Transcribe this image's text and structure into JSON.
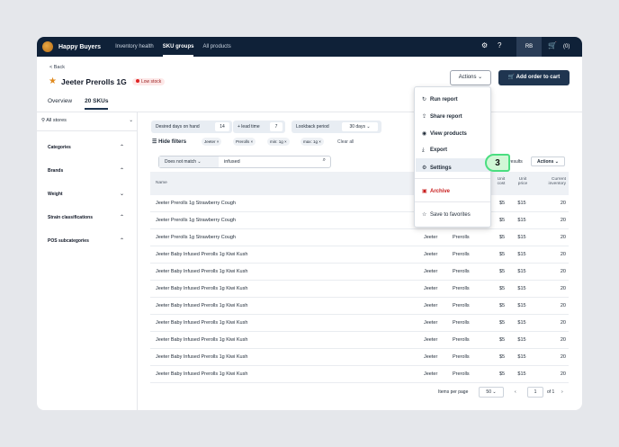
{
  "nav": {
    "brand": "Happy Buyers",
    "links": [
      "Inventory health",
      "SKU groups",
      "All products"
    ],
    "avatar": "RB",
    "cart_count": "(0)"
  },
  "header": {
    "back": "< Back",
    "title": "Jeeter Prerolls 1G",
    "badge": "Low stock",
    "actions": "Actions",
    "add_order": "Add order to cart"
  },
  "tabs": [
    "Overview",
    "20 SKUs"
  ],
  "sidebar": {
    "store": "All stores",
    "facets": [
      "Categories",
      "Brands",
      "Weight",
      "Strain classifications",
      "POS subcategories"
    ]
  },
  "filters": {
    "desired_label": "Desired days on hand",
    "desired_value": "14",
    "lead_label": "+ lead time",
    "lead_value": "7",
    "lookback_label": "Lookback period",
    "lookback_value": "30 days",
    "hide": "Hide filters",
    "chips": [
      "Jeeter",
      "Prerolls",
      "min: 1g",
      "max: 1g"
    ],
    "clear": "Clear all"
  },
  "search": {
    "mode": "Does not match",
    "value": "infused"
  },
  "table": {
    "results": "results",
    "actions": "Actions",
    "headers": {
      "name": "Name",
      "unit_cost": "Unit cost",
      "unit_price": "Unit price",
      "inventory": "Current inventory"
    },
    "rows": [
      {
        "name": "Jeeter Prerolls 1g Strawberry Cough",
        "brand": "",
        "category": "",
        "cost": "$5",
        "price": "$15",
        "inv": "20"
      },
      {
        "name": "Jeeter Prerolls 1g Strawberry Cough",
        "brand": "",
        "category": "",
        "cost": "$5",
        "price": "$15",
        "inv": "20"
      },
      {
        "name": "Jeeter Prerolls 1g Strawberry Cough",
        "brand": "Jeeter",
        "category": "Prerolls",
        "cost": "$5",
        "price": "$15",
        "inv": "20"
      },
      {
        "name": "Jeeter Baby Infused Prerolls 1g Kiwi Kush",
        "brand": "Jeeter",
        "category": "Prerolls",
        "cost": "$5",
        "price": "$15",
        "inv": "20"
      },
      {
        "name": "Jeeter Baby Infused Prerolls 1g Kiwi Kush",
        "brand": "Jeeter",
        "category": "Prerolls",
        "cost": "$5",
        "price": "$15",
        "inv": "20"
      },
      {
        "name": "Jeeter Baby Infused Prerolls 1g Kiwi Kush",
        "brand": "Jeeter",
        "category": "Prerolls",
        "cost": "$5",
        "price": "$15",
        "inv": "20"
      },
      {
        "name": "Jeeter Baby Infused Prerolls 1g Kiwi Kush",
        "brand": "Jeeter",
        "category": "Prerolls",
        "cost": "$5",
        "price": "$15",
        "inv": "20"
      },
      {
        "name": "Jeeter Baby Infused Prerolls 1g Kiwi Kush",
        "brand": "Jeeter",
        "category": "Prerolls",
        "cost": "$5",
        "price": "$15",
        "inv": "20"
      },
      {
        "name": "Jeeter Baby Infused Prerolls 1g Kiwi Kush",
        "brand": "Jeeter",
        "category": "Prerolls",
        "cost": "$5",
        "price": "$15",
        "inv": "20"
      },
      {
        "name": "Jeeter Baby Infused Prerolls 1g Kiwi Kush",
        "brand": "Jeeter",
        "category": "Prerolls",
        "cost": "$5",
        "price": "$15",
        "inv": "20"
      },
      {
        "name": "Jeeter Baby Infused Prerolls 1g Kiwi Kush",
        "brand": "Jeeter",
        "category": "Prerolls",
        "cost": "$5",
        "price": "$15",
        "inv": "20"
      }
    ]
  },
  "pager": {
    "label": "Items per page",
    "per_page": "50",
    "page": "1",
    "of": "of 1"
  },
  "menu": {
    "items": [
      "Run report",
      "Share report",
      "View products",
      "Export",
      "Settings",
      "Archive",
      "Save to favorites"
    ]
  },
  "step": "3",
  "colors": {
    "nav": "#0f2138",
    "primary": "#1f3550",
    "highlight": "#4ade80",
    "danger": "#e02424"
  }
}
